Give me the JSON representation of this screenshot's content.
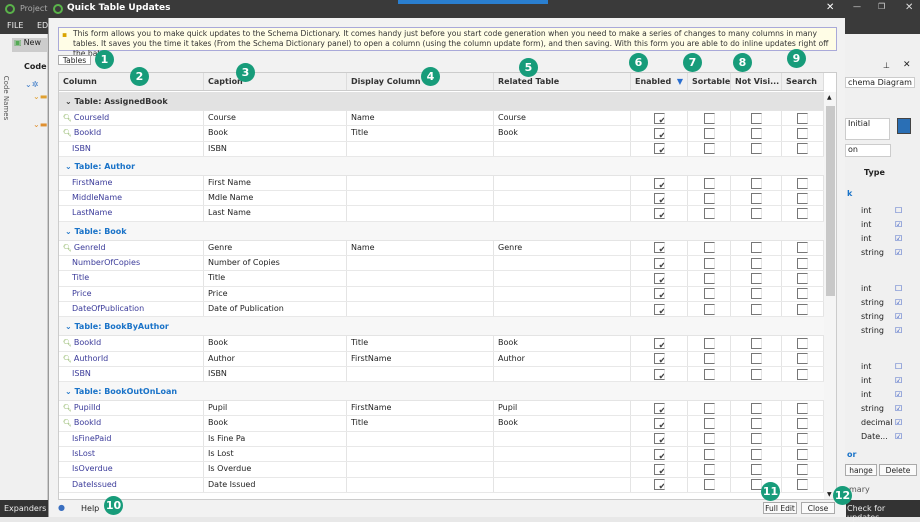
{
  "app": {
    "title": "Project",
    "menu_file": "FILE",
    "menu_edit": "ED",
    "new_label": "New",
    "code_label": "Code",
    "side_tab": "Code Names",
    "status": "Expanders",
    "check_updates": "Check for updates"
  },
  "dialog": {
    "title": "Quick Table Updates",
    "info": "This form allows you to make quick updates to the Schema Dictionary. It comes handy just before you start code generation when you need to make a series of changes to many columns in many tables. It saves you the time it takes (From the Schema Dictionary panel) to open a column (using the column update form), and then saving. With this form you are able to do inline updates right off the bat.",
    "tables_button": "Tables",
    "help": "Help",
    "full_edit": "Full Edit",
    "close": "Close"
  },
  "columns": [
    "Column",
    "Caption",
    "Display Column",
    "Related Table",
    "Enabled",
    "Sortable",
    "Not Visi...",
    "Search"
  ],
  "groups": [
    {
      "name": "Table: AssignedBook",
      "rows": [
        {
          "key": true,
          "col": "CourseId",
          "cap": "Course",
          "disp": "Name",
          "rel": "Course",
          "en": true
        },
        {
          "key": true,
          "col": "BookId",
          "cap": "Book",
          "disp": "Title",
          "rel": "Book",
          "en": true
        },
        {
          "key": false,
          "col": "ISBN",
          "cap": "ISBN",
          "disp": "",
          "rel": "",
          "en": true
        }
      ]
    },
    {
      "name": "Table: Author",
      "rows": [
        {
          "key": false,
          "col": "FirstName",
          "cap": "First Name",
          "disp": "",
          "rel": "",
          "en": true
        },
        {
          "key": false,
          "col": "MiddleName",
          "cap": "Mdle Name",
          "disp": "",
          "rel": "",
          "en": true
        },
        {
          "key": false,
          "col": "LastName",
          "cap": "Last Name",
          "disp": "",
          "rel": "",
          "en": true
        }
      ]
    },
    {
      "name": "Table: Book",
      "rows": [
        {
          "key": true,
          "col": "GenreId",
          "cap": "Genre",
          "disp": "Name",
          "rel": "Genre",
          "en": true
        },
        {
          "key": false,
          "col": "NumberOfCopies",
          "cap": "Number of Copies",
          "disp": "",
          "rel": "",
          "en": true
        },
        {
          "key": false,
          "col": "Title",
          "cap": "Title",
          "disp": "",
          "rel": "",
          "en": true
        },
        {
          "key": false,
          "col": "Price",
          "cap": "Price",
          "disp": "",
          "rel": "",
          "en": true
        },
        {
          "key": false,
          "col": "DateOfPublication",
          "cap": "Date of Publication",
          "disp": "",
          "rel": "",
          "en": true
        }
      ]
    },
    {
      "name": "Table: BookByAuthor",
      "rows": [
        {
          "key": true,
          "col": "BookId",
          "cap": "Book",
          "disp": "Title",
          "rel": "Book",
          "en": true
        },
        {
          "key": true,
          "col": "AuthorId",
          "cap": "Author",
          "disp": "FirstName",
          "rel": "Author",
          "en": true
        },
        {
          "key": false,
          "col": "ISBN",
          "cap": "ISBN",
          "disp": "",
          "rel": "",
          "en": true
        }
      ]
    },
    {
      "name": "Table: BookOutOnLoan",
      "rows": [
        {
          "key": true,
          "col": "PupilId",
          "cap": "Pupil",
          "disp": "FirstName",
          "rel": "Pupil",
          "en": true
        },
        {
          "key": true,
          "col": "BookId",
          "cap": "Book",
          "disp": "Title",
          "rel": "Book",
          "en": true
        },
        {
          "key": false,
          "col": "IsFinePaid",
          "cap": "Is Fine Pa",
          "disp": "",
          "rel": "",
          "en": true
        },
        {
          "key": false,
          "col": "IsLost",
          "cap": "Is Lost",
          "disp": "",
          "rel": "",
          "en": true
        },
        {
          "key": false,
          "col": "IsOverdue",
          "cap": "Is Overdue",
          "disp": "",
          "rel": "",
          "en": true
        },
        {
          "key": false,
          "col": "DateIssued",
          "cap": "Date Issued",
          "disp": "",
          "rel": "",
          "en": true
        }
      ]
    }
  ],
  "right_panel": {
    "search": "chema Diagram",
    "list1": "Initial",
    "field": "on",
    "col_header": "Type",
    "group_label": "k",
    "types": [
      "int",
      "int",
      "int",
      "string",
      "int",
      "string",
      "string",
      "string",
      "int",
      "int",
      "int",
      "string",
      "decimal",
      "Date..."
    ],
    "change": "hange",
    "delete": "Delete",
    "summary": "mary",
    "bottom_label": "or"
  },
  "badges": [
    "1",
    "2",
    "3",
    "4",
    "5",
    "6",
    "7",
    "8",
    "9",
    "10",
    "11",
    "12"
  ]
}
